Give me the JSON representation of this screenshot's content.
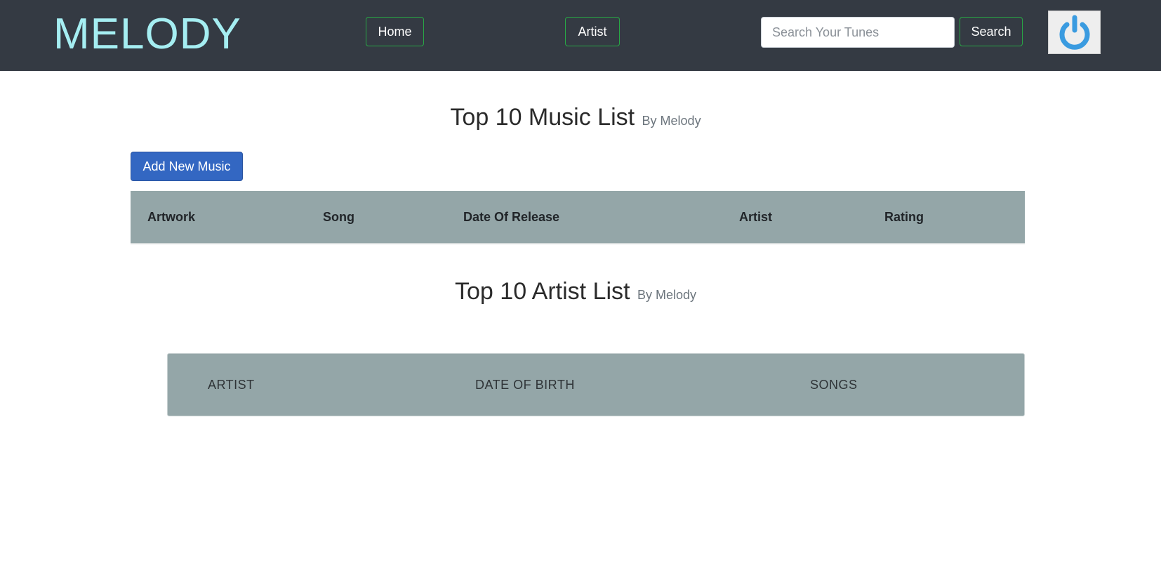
{
  "navbar": {
    "brand": "MELODY",
    "home_label": "Home",
    "artist_label": "Artist",
    "search_placeholder": "Search Your Tunes",
    "search_label": "Search",
    "power_icon": "power-icon"
  },
  "music_section": {
    "title": "Top 10 Music List",
    "subtitle": "By Melody",
    "add_button": "Add New Music",
    "columns": [
      "Artwork",
      "Song",
      "Date Of Release",
      "Artist",
      "Rating"
    ]
  },
  "artist_section": {
    "title": "Top 10 Artist List",
    "subtitle": "By Melody",
    "columns": [
      "ARTIST",
      "DATE OF BIRTH",
      "SONGS"
    ]
  },
  "colors": {
    "navbar_bg": "#343a43",
    "brand": "#a5eef2",
    "nav_border": "#28a745",
    "primary_button": "#3367c2",
    "table_header_bg": "#94a6a8",
    "power_icon": "#3a9be0"
  }
}
